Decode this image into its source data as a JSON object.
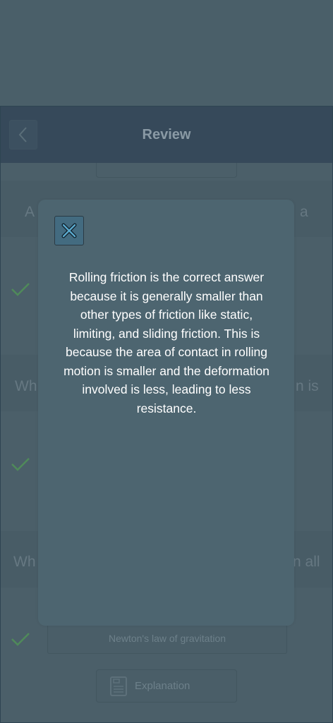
{
  "header": {
    "title": "Review"
  },
  "background": {
    "q1_start": "A",
    "q1_end": "a",
    "q2_start": "Wh",
    "q2_end": "n is",
    "q3_start": "Wh",
    "q3_end": "n all",
    "option_text": "Newton's law of gravitation",
    "explanation_label": "Explanation"
  },
  "modal": {
    "explanation_text": "Rolling friction is the correct answer because it is generally smaller than other types of friction like static, limiting, and sliding friction. This is because the area of contact in rolling motion is smaller and the deformation involved is less, leading to less resistance."
  },
  "icons": {
    "back": "chevron-left-icon",
    "close": "close-icon",
    "check": "check-icon",
    "document": "document-icon"
  },
  "colors": {
    "overlay": "#4a5f69",
    "header": "#36495a",
    "modal": "#4d6570",
    "close_button": "#436b80",
    "check": "#4f8a5a"
  }
}
